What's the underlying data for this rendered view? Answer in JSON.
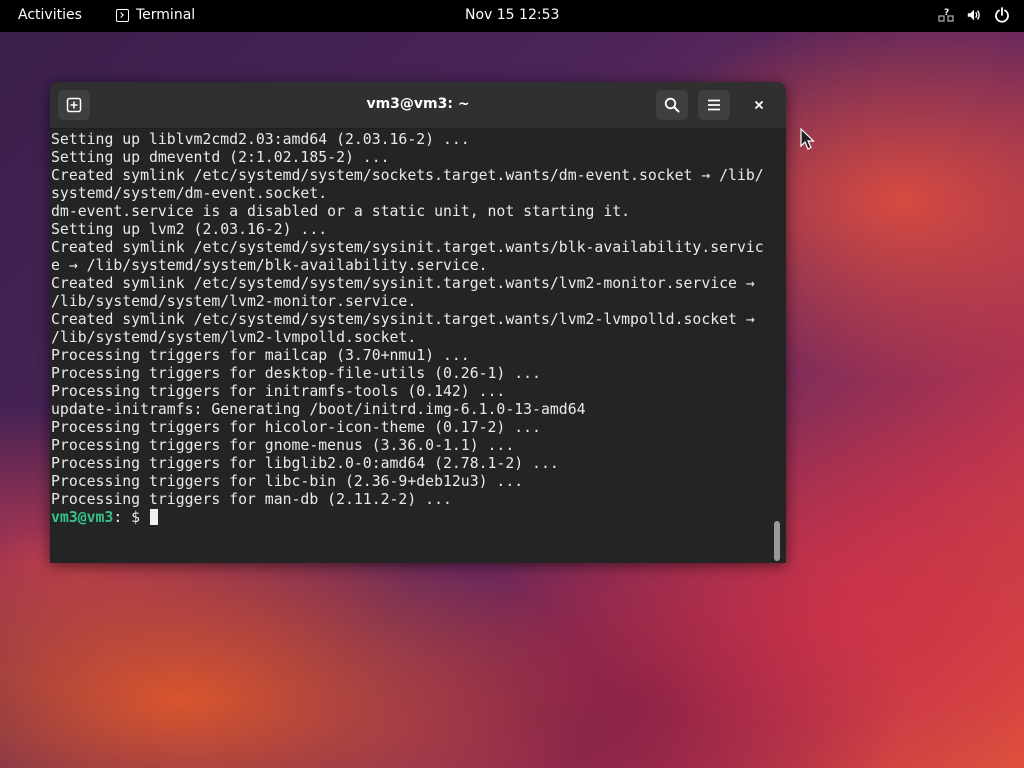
{
  "topbar": {
    "activities_label": "Activities",
    "app_menu_label": "Terminal",
    "clock": "Nov 15  12:53",
    "tray_icons": [
      "network-question-icon",
      "volume-icon",
      "power-icon"
    ]
  },
  "window": {
    "title": "vm3@vm3: ~",
    "buttons": [
      "new-tab-icon",
      "search-icon",
      "hamburger-menu-icon",
      "close-icon"
    ]
  },
  "terminal": {
    "lines": [
      "Setting up liblvm2cmd2.03:amd64 (2.03.16-2) ...",
      "Setting up dmeventd (2:1.02.185-2) ...",
      "Created symlink /etc/systemd/system/sockets.target.wants/dm-event.socket → /lib/",
      "systemd/system/dm-event.socket.",
      "dm-event.service is a disabled or a static unit, not starting it.",
      "Setting up lvm2 (2.03.16-2) ...",
      "Created symlink /etc/systemd/system/sysinit.target.wants/blk-availability.servic",
      "e → /lib/systemd/system/blk-availability.service.",
      "Created symlink /etc/systemd/system/sysinit.target.wants/lvm2-monitor.service →",
      "/lib/systemd/system/lvm2-monitor.service.",
      "Created symlink /etc/systemd/system/sysinit.target.wants/lvm2-lvmpolld.socket →",
      "/lib/systemd/system/lvm2-lvmpolld.socket.",
      "Processing triggers for mailcap (3.70+nmu1) ...",
      "Processing triggers for desktop-file-utils (0.26-1) ...",
      "Processing triggers for initramfs-tools (0.142) ...",
      "update-initramfs: Generating /boot/initrd.img-6.1.0-13-amd64",
      "Processing triggers for hicolor-icon-theme (0.17-2) ...",
      "Processing triggers for gnome-menus (3.36.0-1.1) ...",
      "Processing triggers for libglib2.0-0:amd64 (2.78.1-2) ...",
      "Processing triggers for libc-bin (2.36-9+deb12u3) ...",
      "Processing triggers for man-db (2.11.2-2) ..."
    ],
    "prompt_user": "vm3@vm3",
    "prompt_rest": ": $ ",
    "colors": {
      "background": "#242424",
      "foreground": "#eaeaea",
      "prompt": "#36c28a"
    }
  }
}
